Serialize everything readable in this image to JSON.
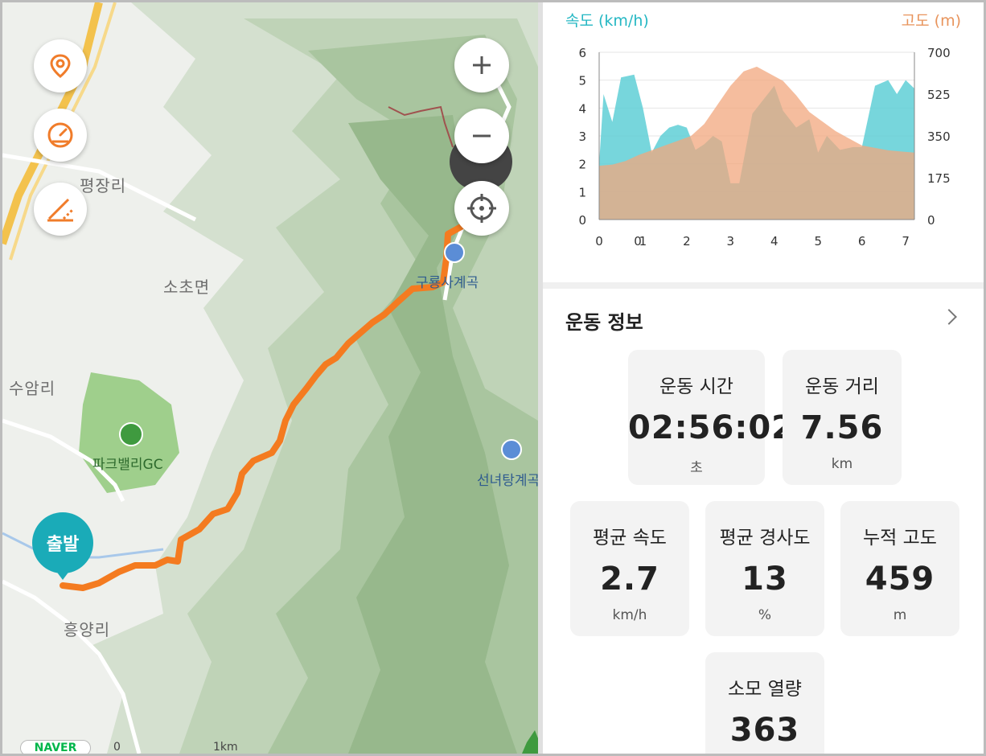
{
  "map": {
    "place_labels": {
      "pyeongjang": "평장리",
      "socho": "소초면",
      "suam": "수암리",
      "heungyang": "흥양리"
    },
    "poi": {
      "gugyong": "구룡사계곡",
      "seonnyeo": "선녀탕계곡",
      "parkvalley": "파크밸리GC"
    },
    "start_marker": "출발",
    "logo": "NAVER",
    "scale": {
      "zero": "0",
      "km": "1km"
    },
    "route_color": "#f47b20",
    "icons": [
      "location-pin-icon",
      "speedometer-icon",
      "slope-icon",
      "zoom-in-icon",
      "zoom-out-icon",
      "locate-icon"
    ]
  },
  "stats_panel": {
    "speed_axis_title": "속도 (km/h)",
    "altitude_axis_title": "고도 (m)",
    "section_title": "운동 정보",
    "cards": {
      "time": {
        "label": "운동 시간",
        "value": "02:56:02",
        "unit": "초"
      },
      "distance": {
        "label": "운동 거리",
        "value": "7.56",
        "unit": "km"
      },
      "avg_speed": {
        "label": "평균 속도",
        "value": "2.7",
        "unit": "km/h"
      },
      "avg_grade": {
        "label": "평균 경사도",
        "value": "13",
        "unit": "%"
      },
      "cum_alt": {
        "label": "누적 고도",
        "value": "459",
        "unit": "m"
      },
      "calories": {
        "label": "소모 열량",
        "value": "363"
      }
    }
  },
  "chart_data": {
    "type": "area",
    "x_ticks": [
      "0",
      "0",
      "1",
      "2",
      "3",
      "4",
      "5",
      "6",
      "7"
    ],
    "y_left_ticks": [
      "0",
      "1",
      "2",
      "3",
      "4",
      "5",
      "6"
    ],
    "y_right_ticks": [
      "0",
      "175",
      "350",
      "525",
      "700"
    ],
    "ylim_left": [
      0,
      6
    ],
    "ylim_right": [
      0,
      700
    ],
    "colors": {
      "speed": "#5fcfd6",
      "altitude": "#f2a77e"
    },
    "series": [
      {
        "axis": "left",
        "x": [
          0,
          0.1,
          0.3,
          0.5,
          0.8,
          1.0,
          1.2,
          1.4,
          1.6,
          1.8,
          2.0,
          2.2,
          2.4,
          2.6,
          2.8,
          3.0,
          3.2,
          3.5,
          3.8,
          4.0,
          4.2,
          4.5,
          4.8,
          5.0,
          5.2,
          5.5,
          5.8,
          6.0,
          6.3,
          6.6,
          6.8,
          7.0,
          7.2
        ],
        "values": [
          2.0,
          4.5,
          3.5,
          5.1,
          5.2,
          4.0,
          2.4,
          3.0,
          3.3,
          3.4,
          3.3,
          2.5,
          2.7,
          3.0,
          2.8,
          1.3,
          1.3,
          3.8,
          4.4,
          4.8,
          3.9,
          3.3,
          3.6,
          2.4,
          3.0,
          2.5,
          2.6,
          2.6,
          4.8,
          5.0,
          4.5,
          5.0,
          4.7
        ]
      },
      {
        "axis": "right",
        "x": [
          0,
          0.3,
          0.6,
          0.9,
          1.2,
          1.5,
          1.8,
          2.1,
          2.4,
          2.7,
          3.0,
          3.3,
          3.6,
          3.9,
          4.2,
          4.5,
          4.8,
          5.1,
          5.4,
          5.7,
          6.0,
          6.3,
          6.6,
          6.9,
          7.2
        ],
        "values": [
          225,
          230,
          245,
          270,
          290,
          310,
          330,
          350,
          400,
          480,
          560,
          620,
          640,
          610,
          580,
          520,
          450,
          410,
          370,
          340,
          310,
          300,
          290,
          285,
          280
        ]
      }
    ]
  }
}
